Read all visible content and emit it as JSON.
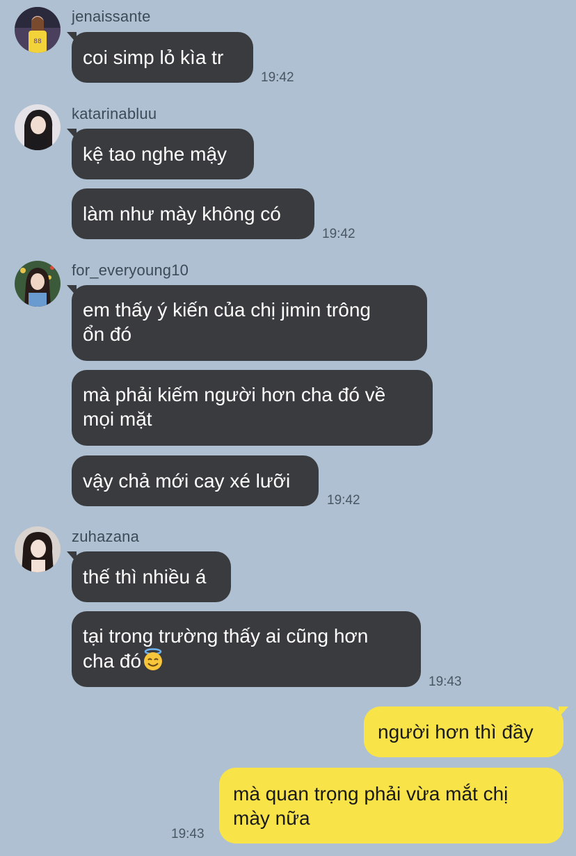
{
  "messages": [
    {
      "user": "jenaissante",
      "texts": [
        "coi simp lỏ kìa tr"
      ],
      "time": "19:42"
    },
    {
      "user": "katarinabluu",
      "texts": [
        "kệ tao nghe mậy",
        "làm như mày không có"
      ],
      "time": "19:42"
    },
    {
      "user": "for_everyoung10",
      "texts": [
        "em thấy ý kiến của chị jimin trông",
        "ổn đó",
        "mà phải kiếm người hơn cha đó về",
        "mọi mặt",
        "vậy chả mới cay xé lưỡi"
      ],
      "time": "19:42"
    },
    {
      "user": "zuhazana",
      "texts": [
        "thế thì nhiều á",
        "tại trong trường thấy ai cũng hơn",
        "cha đó"
      ],
      "time": "19:43"
    }
  ],
  "mine": {
    "texts": [
      "người hơn thì đầy",
      "mà quan trọng phải vừa mắt chị",
      "mày nữa"
    ],
    "time": "19:43"
  },
  "icons": {
    "halo_emoji": "smiling-face-with-halo"
  },
  "colors": {
    "background": "#aec0d1",
    "their_bubble": "#3a3b3e",
    "my_bubble": "#f8e349"
  }
}
